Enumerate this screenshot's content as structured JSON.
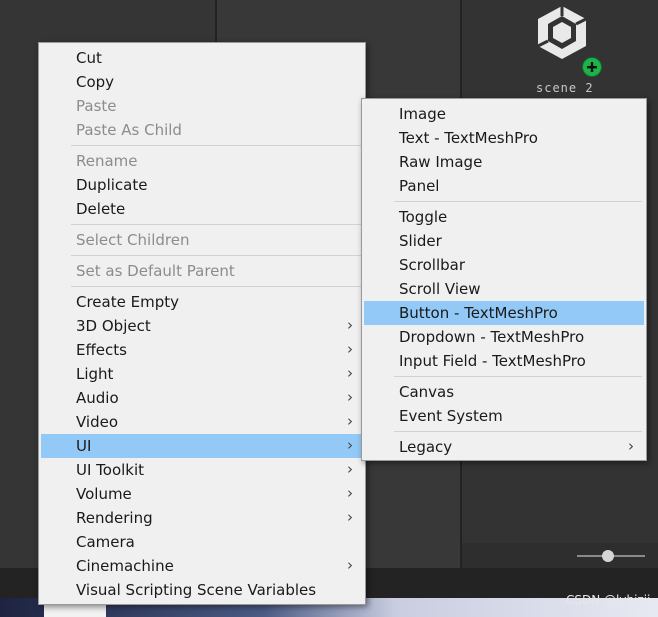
{
  "scene": {
    "label": "scene 2",
    "icon": "unity-scene-add-icon",
    "badge_color": "#1db34a"
  },
  "slider": {
    "value": 0.45
  },
  "watermark": "CSDN @lyhizjj",
  "context_menu": {
    "highlight_color": "#93c9f7",
    "items": [
      {
        "label": "Cut",
        "enabled": true
      },
      {
        "label": "Copy",
        "enabled": true
      },
      {
        "label": "Paste",
        "enabled": false
      },
      {
        "label": "Paste As Child",
        "enabled": false
      },
      {
        "label": "Rename",
        "enabled": false
      },
      {
        "label": "Duplicate",
        "enabled": true
      },
      {
        "label": "Delete",
        "enabled": true
      },
      {
        "label": "Select Children",
        "enabled": false
      },
      {
        "label": "Set as Default Parent",
        "enabled": false
      },
      {
        "label": "Create Empty",
        "enabled": true
      },
      {
        "label": "3D Object",
        "enabled": true,
        "submenu": true
      },
      {
        "label": "Effects",
        "enabled": true,
        "submenu": true
      },
      {
        "label": "Light",
        "enabled": true,
        "submenu": true
      },
      {
        "label": "Audio",
        "enabled": true,
        "submenu": true
      },
      {
        "label": "Video",
        "enabled": true,
        "submenu": true
      },
      {
        "label": "UI",
        "enabled": true,
        "submenu": true,
        "highlighted": true
      },
      {
        "label": "UI Toolkit",
        "enabled": true,
        "submenu": true
      },
      {
        "label": "Volume",
        "enabled": true,
        "submenu": true
      },
      {
        "label": "Rendering",
        "enabled": true,
        "submenu": true
      },
      {
        "label": "Camera",
        "enabled": true
      },
      {
        "label": "Cinemachine",
        "enabled": true,
        "submenu": true
      },
      {
        "label": "Visual Scripting Scene Variables",
        "enabled": true
      }
    ]
  },
  "ui_submenu": {
    "items": [
      {
        "label": "Image"
      },
      {
        "label": "Text - TextMeshPro"
      },
      {
        "label": "Raw Image"
      },
      {
        "label": "Panel"
      },
      {
        "label": "Toggle"
      },
      {
        "label": "Slider"
      },
      {
        "label": "Scrollbar"
      },
      {
        "label": "Scroll View"
      },
      {
        "label": "Button - TextMeshPro",
        "highlighted": true
      },
      {
        "label": "Dropdown - TextMeshPro"
      },
      {
        "label": "Input Field - TextMeshPro"
      },
      {
        "label": "Canvas"
      },
      {
        "label": "Event System"
      },
      {
        "label": "Legacy",
        "submenu": true
      }
    ]
  }
}
